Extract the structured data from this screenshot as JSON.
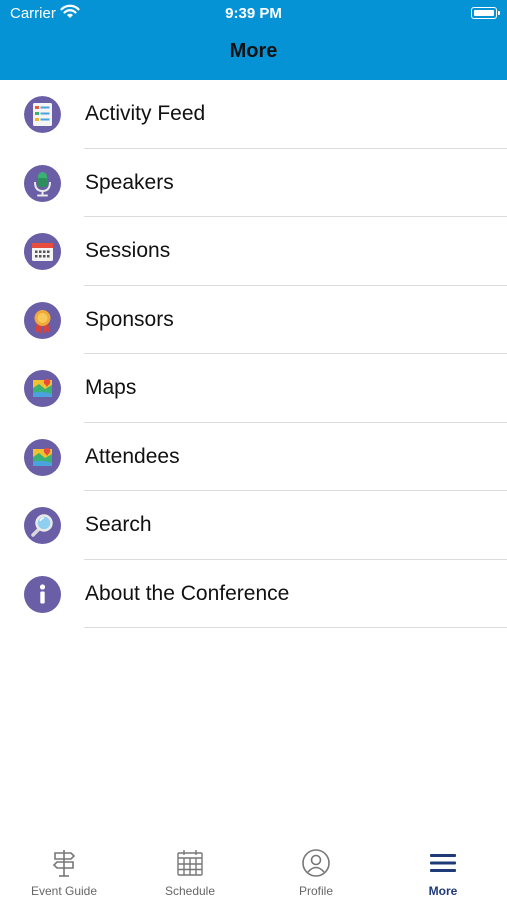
{
  "status_bar": {
    "carrier": "Carrier",
    "time": "9:39 PM"
  },
  "nav": {
    "title": "More"
  },
  "menu": [
    {
      "label": "Activity Feed",
      "icon": "activity-feed-icon"
    },
    {
      "label": "Speakers",
      "icon": "microphone-icon"
    },
    {
      "label": "Sessions",
      "icon": "calendar-icon"
    },
    {
      "label": "Sponsors",
      "icon": "award-ribbon-icon"
    },
    {
      "label": "Maps",
      "icon": "map-icon"
    },
    {
      "label": "Attendees",
      "icon": "attendees-map-icon"
    },
    {
      "label": "Search",
      "icon": "magnifier-icon"
    },
    {
      "label": "About the Conference",
      "icon": "info-icon"
    }
  ],
  "tabs": [
    {
      "label": "Event Guide",
      "icon": "signpost-icon",
      "active": false
    },
    {
      "label": "Schedule",
      "icon": "calendar-grid-icon",
      "active": false
    },
    {
      "label": "Profile",
      "icon": "user-circle-icon",
      "active": false
    },
    {
      "label": "More",
      "icon": "hamburger-menu-icon",
      "active": true
    }
  ],
  "colors": {
    "header": "#0693d6",
    "icon_bg": "#6a5ea7",
    "active_tab": "#1f3a78"
  }
}
